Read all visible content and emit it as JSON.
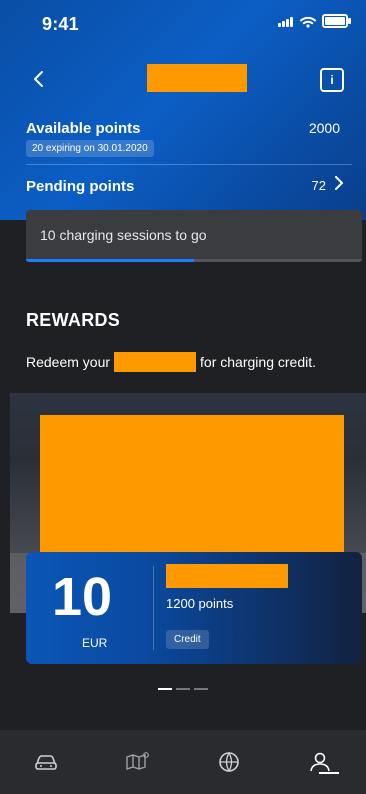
{
  "status_bar": {
    "time": "9:41"
  },
  "header": {
    "available_points_label": "Available points",
    "available_points_value": "2000",
    "expiry_text": "20 expiring on 30.01.2020",
    "pending_points_label": "Pending points",
    "pending_points_value": "72"
  },
  "session_card": {
    "text": "10 charging sessions to go",
    "progress": 0.5
  },
  "rewards": {
    "title": "REWARDS",
    "sub_before": "Redeem your",
    "sub_after": "for charging credit."
  },
  "offer": {
    "amount": "10",
    "currency": "EUR",
    "points": "1200 points",
    "badge": "Credit"
  },
  "carousel": {
    "count": 3,
    "active_index": 0
  },
  "tabs": {
    "items": [
      {
        "name": "car-icon"
      },
      {
        "name": "map-icon"
      },
      {
        "name": "globe-icon"
      },
      {
        "name": "profile-icon"
      }
    ],
    "active_index": 3
  },
  "colors": {
    "accent": "#1a7cff",
    "header_blue": "#0b5ec5",
    "redaction": "#ff9900",
    "background": "#1f2023"
  }
}
